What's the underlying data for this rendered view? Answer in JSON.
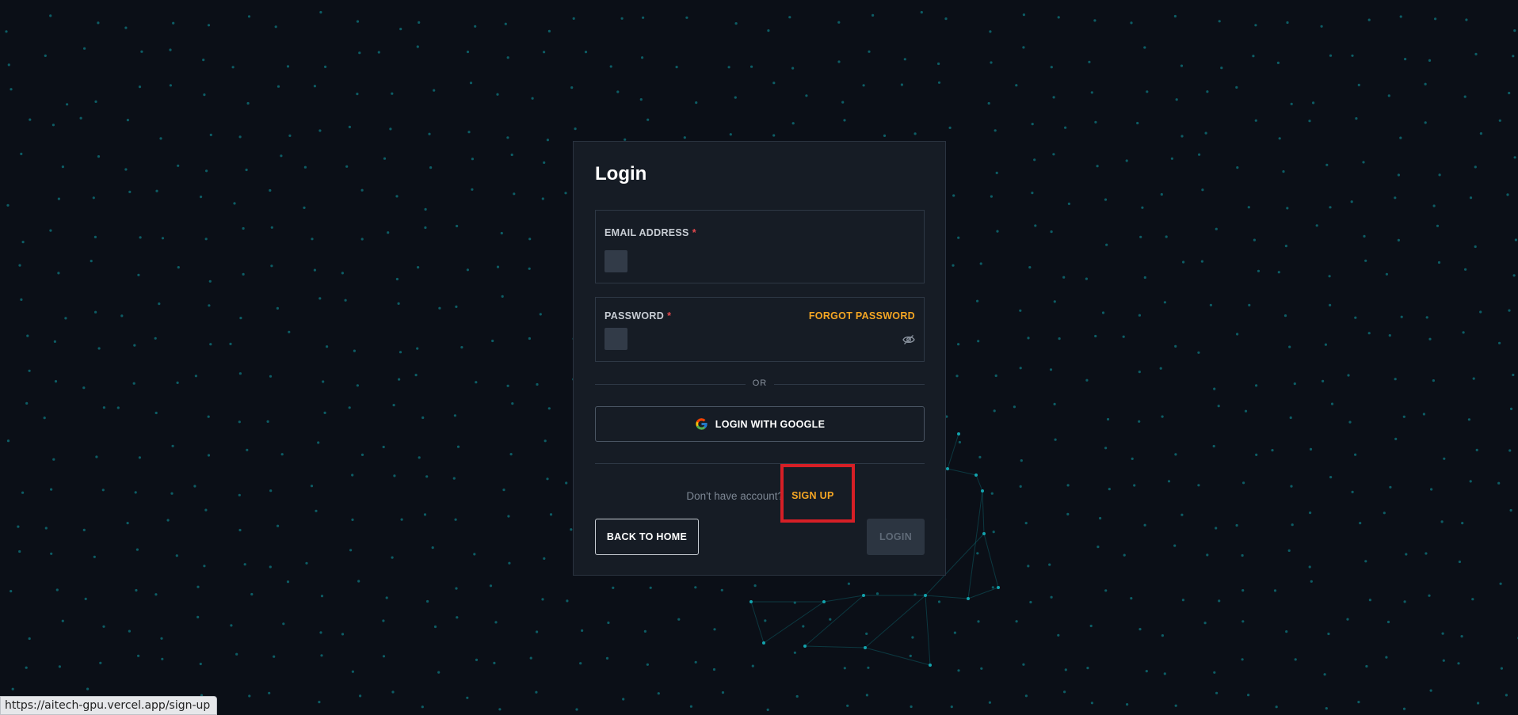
{
  "login": {
    "title": "Login",
    "email": {
      "label": "EMAIL ADDRESS",
      "required_mark": "*",
      "value": ""
    },
    "password": {
      "label": "PASSWORD",
      "required_mark": "*",
      "forgot_label": "FORGOT PASSWORD",
      "value": ""
    },
    "divider_text": "OR",
    "google_button_label": "LOGIN WITH GOOGLE",
    "signup_prompt": "Don't have account?",
    "signup_link": "SIGN UP",
    "back_button_label": "BACK TO HOME",
    "login_button_label": "LOGIN"
  },
  "status_bar": {
    "url": "https://aitech-gpu.vercel.app/sign-up"
  },
  "colors": {
    "background": "#0b0f17",
    "card": "#161c25",
    "accent": "#f5a623",
    "dots": "#0e6b73",
    "highlight": "#d61f26"
  },
  "icons": [
    "eye-slash-icon",
    "google-icon"
  ]
}
